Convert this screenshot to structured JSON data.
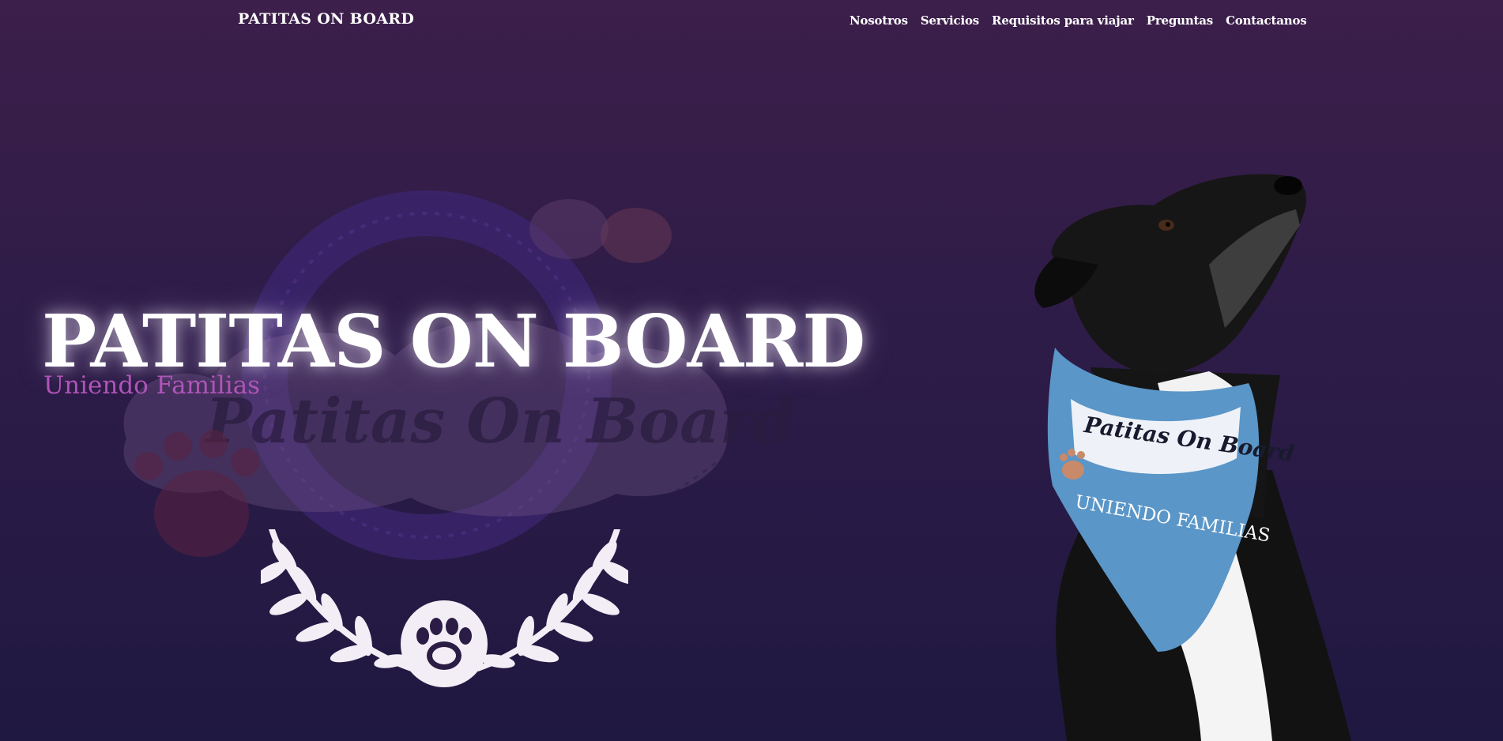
{
  "header": {
    "brand": "PATITAS ON BOARD",
    "nav": [
      {
        "label": "Nosotros"
      },
      {
        "label": "Servicios"
      },
      {
        "label": "Requisitos para viajar"
      },
      {
        "label": "Preguntas"
      },
      {
        "label": "Contactanos"
      }
    ]
  },
  "hero": {
    "title": "PATITAS ON BOARD",
    "subtitle": "Uniendo Familias",
    "background_logo_text": "Patitas On Board",
    "bandana_text_top": "Patitas On Board",
    "bandana_text_bottom": "UNIENDO FAMILIAS"
  },
  "colors": {
    "background_top": "#3c1f4a",
    "background_bottom": "#1f1840",
    "subtitle": "#b054b8",
    "bandana": "#5a96c8"
  },
  "icons": [
    "paw-laurel-icon",
    "airplane-icon",
    "paw-icon"
  ]
}
